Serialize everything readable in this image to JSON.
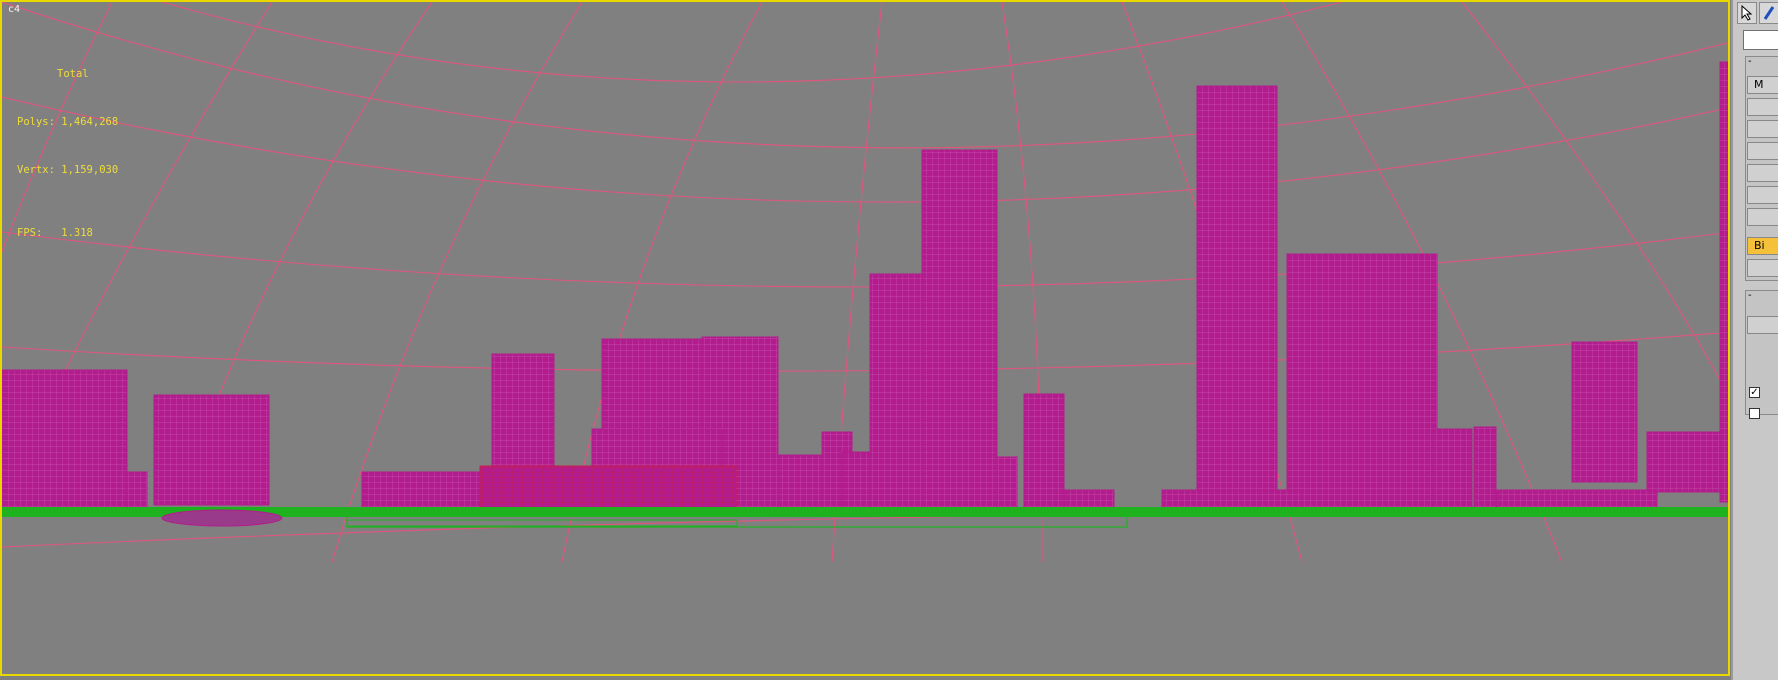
{
  "viewport": {
    "label": "c4",
    "stats": {
      "header": "Total",
      "polys_label": "Polys:",
      "polys_value": "1,464,268",
      "verts_label": "Vertx:",
      "verts_value": "1,159,030",
      "fps_label": "FPS:",
      "fps_value": "1.318"
    },
    "colors": {
      "background": "#808080",
      "border": "#e8d800",
      "grid": "#e0557e",
      "buildings": "#b21c8c",
      "ground": "#1fb21f",
      "selected": "#c81e50",
      "stats_text": "#f0dc3a"
    }
  },
  "command_panel": {
    "tools": [
      "select-cursor-icon",
      "modify-icon"
    ],
    "buttons": [
      "M",
      "",
      "",
      "",
      "",
      "",
      "",
      "Bi",
      ""
    ],
    "highlighted_button": "Bi",
    "checkbox_1_checked": true,
    "checkbox_2_checked": false,
    "rollout_1_toggle": "-",
    "rollout_2_toggle": "-"
  }
}
